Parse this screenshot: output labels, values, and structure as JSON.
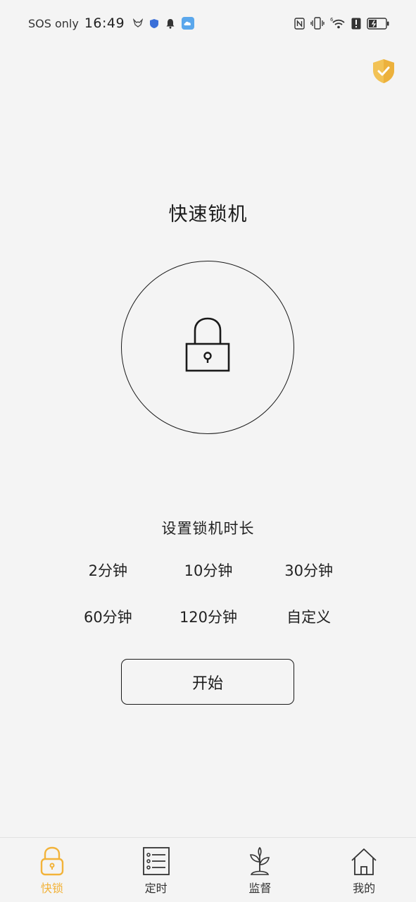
{
  "status_bar": {
    "carrier": "SOS only",
    "time": "16:49",
    "signal_label": "6"
  },
  "main": {
    "title": "快速锁机",
    "duration_heading": "设置锁机时长",
    "durations": [
      "2分钟",
      "10分钟",
      "30分钟",
      "60分钟",
      "120分钟",
      "自定义"
    ],
    "start_label": "开始"
  },
  "nav": {
    "items": [
      {
        "label": "快锁",
        "icon": "lock-icon",
        "active": true
      },
      {
        "label": "定时",
        "icon": "checklist-icon",
        "active": false
      },
      {
        "label": "监督",
        "icon": "sprout-icon",
        "active": false
      },
      {
        "label": "我的",
        "icon": "home-icon",
        "active": false
      }
    ]
  },
  "colors": {
    "accent": "#f2b33a",
    "background": "#f4f4f4",
    "text": "#1a1a1a"
  }
}
